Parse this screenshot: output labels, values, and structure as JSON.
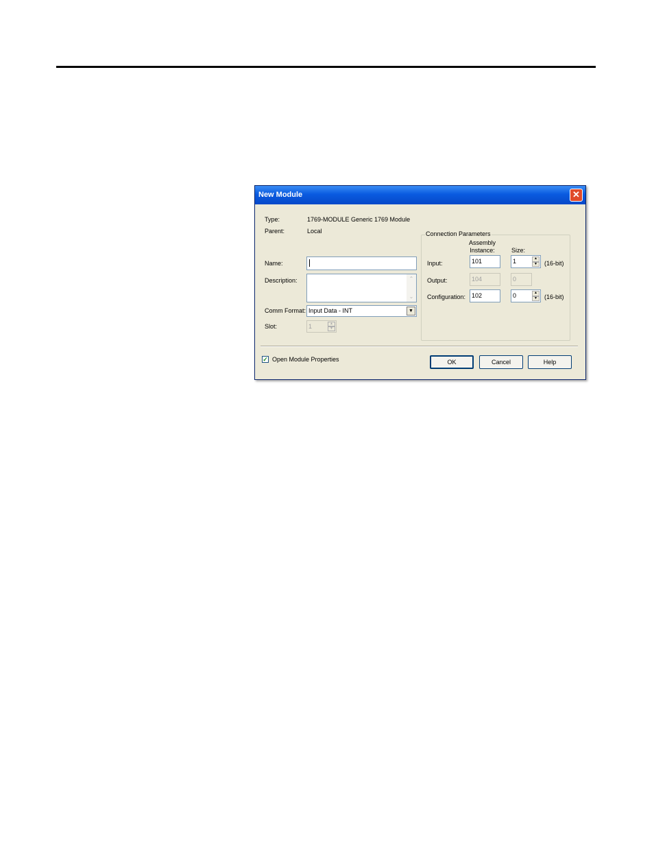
{
  "dialog": {
    "title": "New Module",
    "close_glyph": "✕",
    "fields": {
      "type_label": "Type:",
      "type_value": "1769-MODULE Generic 1769 Module",
      "parent_label": "Parent:",
      "parent_value": "Local",
      "name_label": "Name:",
      "name_value": "",
      "description_label": "Description:",
      "description_value": "",
      "comm_format_label": "Comm Format:",
      "comm_format_value": "Input Data - INT",
      "slot_label": "Slot:",
      "slot_value": "1"
    },
    "connection": {
      "legend": "Connection Parameters",
      "header_assembly": "Assembly\nInstance:",
      "header_size": "Size:",
      "rows": [
        {
          "label": "Input:",
          "assembly": "101",
          "size": "1",
          "unit": "(16-bit)"
        },
        {
          "label": "Output:",
          "assembly": "104",
          "size": "0",
          "unit": ""
        },
        {
          "label": "Configuration:",
          "assembly": "102",
          "size": "0",
          "unit": "(16-bit)"
        }
      ]
    },
    "open_properties": {
      "label": "Open Module Properties",
      "checked": true,
      "check_glyph": "✓"
    },
    "buttons": {
      "ok": "OK",
      "cancel": "Cancel",
      "help": "Help"
    },
    "icons": {
      "spin_up": "▲",
      "spin_down": "▼",
      "dropdown": "▼",
      "scroll_up": "⌃",
      "scroll_down": "⌄"
    }
  }
}
